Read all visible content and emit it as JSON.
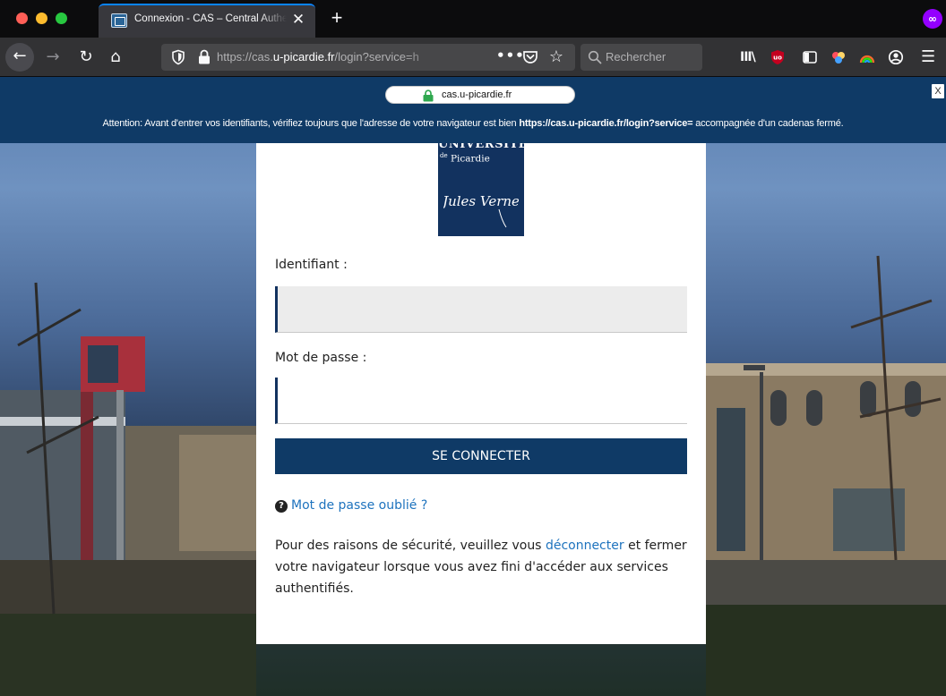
{
  "browser": {
    "tab": {
      "title": "Connexion - CAS – Central Authentication Service",
      "close_glyph": "✕"
    },
    "new_tab_glyph": "+",
    "extension_glyph": "∞",
    "urlbar": {
      "scheme": "https://cas.",
      "domain": "u-picardie.fr",
      "path": "/login?service=h",
      "more_glyph": "•••"
    },
    "searchbar": {
      "placeholder": "Rechercher"
    },
    "library_glyph": "III\\",
    "menu_glyph": "☰",
    "nav_glyphs": {
      "back": "←",
      "forward": "→",
      "reload": "↻",
      "home": "⌂",
      "star": "☆"
    }
  },
  "banner": {
    "domain": "cas.u-picardie.fr",
    "warning_prefix": "Attention: Avant d'entrer vos identifiants, vérifiez toujours que l'adresse de votre navigateur est bien ",
    "warning_url": "https://cas.u-picardie.fr/login?service=",
    "warning_suffix": " accompagnée d'un cadenas fermé.",
    "close_label": "X"
  },
  "logo": {
    "top": "UNIVERSITÉ",
    "prefix": "de",
    "sub": "Picardie",
    "signature": "Jules Verne"
  },
  "form": {
    "username_label": "Identifiant :",
    "username_value": "",
    "password_label": "Mot de passe :",
    "password_value": "",
    "submit_label": "SE CONNECTER",
    "help_glyph": "?",
    "forgot_label": "Mot de passe oublié ?"
  },
  "security_message": {
    "before": "Pour des raisons de sécurité, veuillez vous ",
    "link": "déconnecter",
    "after": " et fermer votre navigateur lorsque vous avez fini d'accéder aux services authentifiés."
  },
  "colors": {
    "banner_bg": "#0f3a66",
    "button_bg": "#0f3a66",
    "logo_bg": "#12325f",
    "link": "#1e73be",
    "tab_accent": "#0a84ff"
  }
}
